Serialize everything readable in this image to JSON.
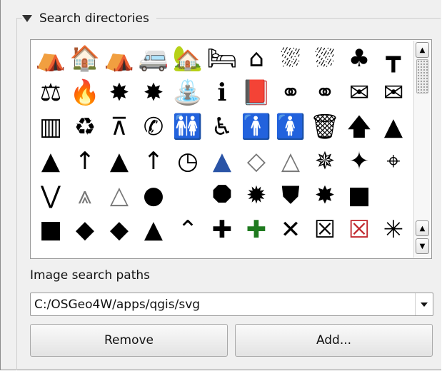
{
  "group": {
    "title": "Search directories",
    "collapse_icon": "triangle-down-icon"
  },
  "icon_grid": {
    "icons": [
      {
        "name": "hiker-shelter-icon",
        "glyph": "⛺"
      },
      {
        "name": "bed-and-breakfast-icon",
        "glyph": "🏠"
      },
      {
        "name": "tent-icon",
        "glyph": "⛺"
      },
      {
        "name": "caravan-icon",
        "glyph": "🚐"
      },
      {
        "name": "chalet-icon",
        "glyph": "🏡"
      },
      {
        "name": "hotel-bed-icon",
        "glyph": "🛏"
      },
      {
        "name": "house-icon",
        "glyph": "⌂"
      },
      {
        "name": "shelter-rain-icon",
        "glyph": "⛆"
      },
      {
        "name": "shelter-rain-2-icon",
        "glyph": "⛆"
      },
      {
        "name": "tree-house-icon",
        "glyph": "♣"
      },
      {
        "name": "picnic-table-icon",
        "glyph": "┳"
      },
      {
        "name": "justice-scales-icon",
        "glyph": "⚖"
      },
      {
        "name": "fire-icon",
        "glyph": "🔥"
      },
      {
        "name": "fire-station-icon",
        "glyph": "✸"
      },
      {
        "name": "fire-station-2-icon",
        "glyph": "✸"
      },
      {
        "name": "fountain-icon",
        "glyph": "⛲"
      },
      {
        "name": "information-icon",
        "glyph": "ℹ"
      },
      {
        "name": "library-book-icon",
        "glyph": "📕"
      },
      {
        "name": "handcuffs-icon",
        "glyph": "⚭"
      },
      {
        "name": "police-handcuffs-icon",
        "glyph": "⚭"
      },
      {
        "name": "post-box-icon",
        "glyph": "✉"
      },
      {
        "name": "post-office-icon",
        "glyph": "✉"
      },
      {
        "name": "prison-icon",
        "glyph": "▥"
      },
      {
        "name": "recycling-icon",
        "glyph": "♻"
      },
      {
        "name": "surveyor-tripod-icon",
        "glyph": "⊼"
      },
      {
        "name": "telephone-icon",
        "glyph": "✆"
      },
      {
        "name": "toilets-icon",
        "glyph": "🚻"
      },
      {
        "name": "wheelchair-wc-icon",
        "glyph": "♿"
      },
      {
        "name": "male-wc-icon",
        "glyph": "🚹"
      },
      {
        "name": "female-wc-icon",
        "glyph": "🚺"
      },
      {
        "name": "waste-basket-icon",
        "glyph": "🗑"
      },
      {
        "name": "arrow-up-icon",
        "glyph": "🡅"
      },
      {
        "name": "north-arrow-icon",
        "glyph": "▲"
      },
      {
        "name": "north-arrow-2-icon",
        "glyph": "▲"
      },
      {
        "name": "north-arrow-3-icon",
        "glyph": "↑"
      },
      {
        "name": "north-arrow-4-icon",
        "glyph": "▲"
      },
      {
        "name": "north-arrow-5-icon",
        "glyph": "↑"
      },
      {
        "name": "north-circle-icon",
        "glyph": "◷"
      },
      {
        "name": "north-arrow-blue-icon",
        "glyph": "▲"
      },
      {
        "name": "compass-needle-icon",
        "glyph": "◇"
      },
      {
        "name": "north-arrow-6-icon",
        "glyph": "△"
      },
      {
        "name": "compass-rose-icon",
        "glyph": "✵"
      },
      {
        "name": "compass-star-icon",
        "glyph": "✦"
      },
      {
        "name": "compass-cross-icon",
        "glyph": "⌖"
      },
      {
        "name": "cable-line-icon",
        "glyph": "⋁"
      },
      {
        "name": "north-arrow-triangle-icon",
        "glyph": "⩓"
      },
      {
        "name": "north-arrow-hollow-icon",
        "glyph": "△"
      },
      {
        "name": "circle-icon",
        "glyph": "●"
      },
      {
        "name": "blank-icon",
        "glyph": " "
      },
      {
        "name": "octagon-icon",
        "glyph": "⯃"
      },
      {
        "name": "gear-shape-icon",
        "glyph": "✹"
      },
      {
        "name": "shield-icon",
        "glyph": "⛊"
      },
      {
        "name": "star-burst-icon",
        "glyph": "✸"
      },
      {
        "name": "square-icon",
        "glyph": "■"
      },
      {
        "name": "blank-2-icon",
        "glyph": " "
      },
      {
        "name": "rounded-square-icon",
        "glyph": "■"
      },
      {
        "name": "diamond-icon",
        "glyph": "◆"
      },
      {
        "name": "diamond-2-icon",
        "glyph": "◆"
      },
      {
        "name": "triangle-icon",
        "glyph": "▲"
      },
      {
        "name": "chevron-line-icon",
        "glyph": "⌃"
      },
      {
        "name": "cross-dot-icon",
        "glyph": "✚"
      },
      {
        "name": "cross-green-dot-icon",
        "glyph": "✚"
      },
      {
        "name": "x-cross-icon",
        "glyph": "✕"
      },
      {
        "name": "x-box-icon",
        "glyph": "☒"
      },
      {
        "name": "x-box-red-icon",
        "glyph": "☒"
      },
      {
        "name": "asterisk-icon",
        "glyph": "✳"
      }
    ]
  },
  "scrollbar": {
    "up_icon": "arrow-up-icon",
    "down_icon": "arrow-down-icon"
  },
  "paths": {
    "label": "Image search paths",
    "selected": "C:/OSGeo4W/apps/qgis/svg"
  },
  "buttons": {
    "remove": "Remove",
    "add": "Add..."
  }
}
